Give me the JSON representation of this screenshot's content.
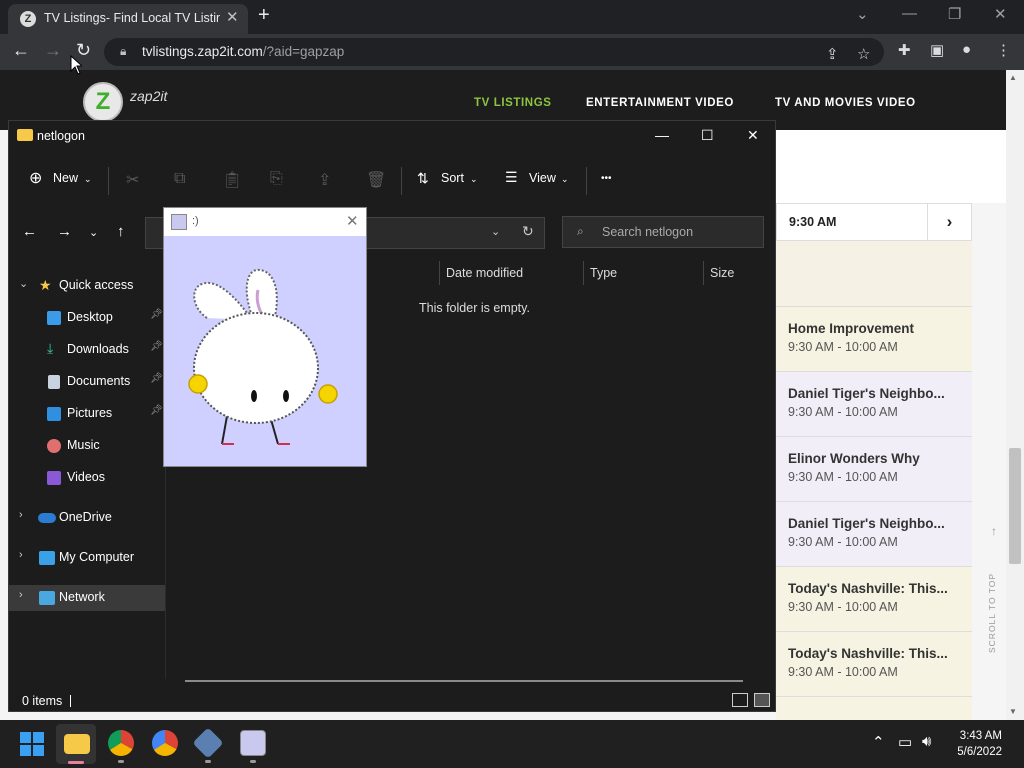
{
  "browser": {
    "tab_title": "TV Listings- Find Local TV Listings",
    "tab_favicon_letter": "Z",
    "url_host": "tvlistings.zap2it.com",
    "url_query": "/?aid=gapzap"
  },
  "site": {
    "logo_letter": "Z",
    "logo_text": "zap2it",
    "nav": [
      "TV LISTINGS",
      "ENTERTAINMENT VIDEO",
      "TV AND MOVIES VIDEO"
    ],
    "active_nav_color": "#8dc63f",
    "grid_time": "9:30 AM",
    "next_arrow": "›",
    "scroll_to_top": "SCROLL TO TOP",
    "listings": [
      {
        "title": "Home Improvement",
        "time": "9:30 AM - 10:00 AM"
      },
      {
        "title": "Daniel Tiger's Neighbo...",
        "time": "9:30 AM - 10:00 AM"
      },
      {
        "title": "Elinor Wonders Why",
        "time": "9:30 AM - 10:00 AM"
      },
      {
        "title": "Daniel Tiger's Neighbo...",
        "time": "9:30 AM - 10:00 AM"
      },
      {
        "title": "Today's Nashville: This...",
        "time": "9:30 AM - 10:00 AM"
      },
      {
        "title": "Today's Nashville: This...",
        "time": "9:30 AM - 10:00 AM"
      }
    ]
  },
  "explorer": {
    "title": "netlogon",
    "cmd_new": "New",
    "cmd_sort": "Sort",
    "cmd_view": "View",
    "cmd_more": "•••",
    "search_placeholder": "Search netlogon",
    "columns": [
      "Date modified",
      "Type",
      "Size"
    ],
    "empty_text": "This folder is empty.",
    "status": "0 items",
    "nav": {
      "quick_access": "Quick access",
      "desktop": "Desktop",
      "downloads": "Downloads",
      "documents": "Documents",
      "pictures": "Pictures",
      "music": "Music",
      "videos": "Videos",
      "onedrive": "OneDrive",
      "my_computer": "My Computer",
      "network": "Network"
    }
  },
  "popup": {
    "title": ":)"
  },
  "taskbar": {
    "time": "3:43 AM",
    "date": "5/6/2022"
  }
}
